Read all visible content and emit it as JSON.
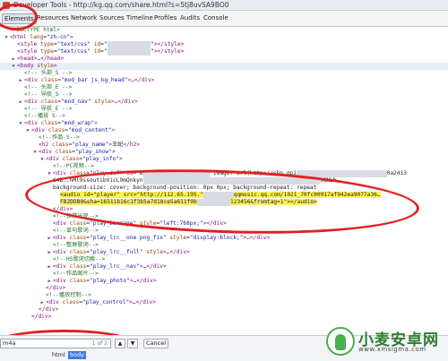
{
  "window": {
    "title": "Developer Tools - http://kg.qq.com/share.html?s=5tj8uvSA9BO0"
  },
  "tabs": [
    "Elements",
    "Resources",
    "Network",
    "Sources",
    "Timeline",
    "Profiles",
    "Audits",
    "Console"
  ],
  "selected_tab": "Elements",
  "code_lines": [
    {
      "indent": 0,
      "arrow": "",
      "segs": [
        {
          "c": "cmt",
          "t": "<!DOCTYPE html>"
        }
      ]
    },
    {
      "indent": 0,
      "arrow": "▼",
      "segs": [
        {
          "c": "tag",
          "t": "<html "
        },
        {
          "c": "attr",
          "t": "lang"
        },
        {
          "c": "plain",
          "t": "="
        },
        {
          "c": "val",
          "t": "\"zh-cn\""
        },
        {
          "c": "tag",
          "t": ">"
        }
      ]
    },
    {
      "indent": 1,
      "arrow": "",
      "segs": [
        {
          "c": "tag",
          "t": "<style "
        },
        {
          "c": "attr",
          "t": "type"
        },
        {
          "c": "plain",
          "t": "="
        },
        {
          "c": "val",
          "t": "\"text/css\" "
        },
        {
          "c": "attr",
          "t": "id"
        },
        {
          "c": "plain",
          "t": "=\""
        },
        {
          "c": "blur",
          "t": "xxxxxxxxxxxxx"
        },
        {
          "c": "plain",
          "t": "\""
        },
        {
          "c": "tag",
          "t": "></style>"
        }
      ]
    },
    {
      "indent": 1,
      "arrow": "",
      "segs": [
        {
          "c": "tag",
          "t": "<style "
        },
        {
          "c": "attr",
          "t": "type"
        },
        {
          "c": "plain",
          "t": "="
        },
        {
          "c": "val",
          "t": "\"text/css\" "
        },
        {
          "c": "attr",
          "t": "id"
        },
        {
          "c": "plain",
          "t": "=\""
        },
        {
          "c": "blur",
          "t": "xxxxxxxxxxxxx"
        },
        {
          "c": "plain",
          "t": "\""
        },
        {
          "c": "tag",
          "t": "></style>"
        }
      ]
    },
    {
      "indent": 1,
      "arrow": "▶",
      "segs": [
        {
          "c": "tag",
          "t": "<head>"
        },
        {
          "c": "plain",
          "t": "…"
        },
        {
          "c": "tag",
          "t": "</head>"
        }
      ]
    },
    {
      "indent": 1,
      "arrow": "▼",
      "segs": [
        {
          "c": "tag",
          "t": "<body "
        },
        {
          "c": "attr",
          "t": "style"
        },
        {
          "c": "tag",
          "t": ">"
        }
      ]
    },
    {
      "indent": 2,
      "arrow": "",
      "segs": [
        {
          "c": "cmt",
          "t": "<!-- 头部_S -->"
        }
      ]
    },
    {
      "indent": 2,
      "arrow": "▶",
      "segs": [
        {
          "c": "tag",
          "t": "<div "
        },
        {
          "c": "attr",
          "t": "class"
        },
        {
          "c": "plain",
          "t": "="
        },
        {
          "c": "val",
          "t": "\"mod_bar js_kg_head\""
        },
        {
          "c": "tag",
          "t": ">"
        },
        {
          "c": "plain",
          "t": "…"
        },
        {
          "c": "tag",
          "t": "</div>"
        }
      ]
    },
    {
      "indent": 2,
      "arrow": "",
      "segs": [
        {
          "c": "cmt",
          "t": "<!-- 头部_E -->"
        }
      ]
    },
    {
      "indent": 2,
      "arrow": "",
      "segs": [
        {
          "c": "cmt",
          "t": "<!-- 导航_S -->"
        }
      ]
    },
    {
      "indent": 2,
      "arrow": "▶",
      "segs": [
        {
          "c": "tag",
          "t": "<div "
        },
        {
          "c": "attr",
          "t": "class"
        },
        {
          "c": "plain",
          "t": "="
        },
        {
          "c": "val",
          "t": "\"mod_nav\" "
        },
        {
          "c": "attr",
          "t": "style"
        },
        {
          "c": "tag",
          "t": ">"
        },
        {
          "c": "plain",
          "t": "…"
        },
        {
          "c": "tag",
          "t": "</div>"
        }
      ]
    },
    {
      "indent": 2,
      "arrow": "",
      "segs": [
        {
          "c": "cmt",
          "t": "<!-- 导航_E -->"
        }
      ]
    },
    {
      "indent": 2,
      "arrow": "",
      "segs": [
        {
          "c": "cmt",
          "t": "<!--播放 S-->"
        }
      ]
    },
    {
      "indent": 2,
      "arrow": "▼",
      "segs": [
        {
          "c": "tag",
          "t": "<div "
        },
        {
          "c": "attr",
          "t": "class"
        },
        {
          "c": "plain",
          "t": "="
        },
        {
          "c": "val",
          "t": "\"mod_wrap\""
        },
        {
          "c": "tag",
          "t": ">"
        }
      ]
    },
    {
      "indent": 3,
      "arrow": "▼",
      "segs": [
        {
          "c": "tag",
          "t": "<div "
        },
        {
          "c": "attr",
          "t": "class"
        },
        {
          "c": "plain",
          "t": "="
        },
        {
          "c": "val",
          "t": "\"mod_content\""
        },
        {
          "c": "tag",
          "t": ">"
        }
      ]
    },
    {
      "indent": 4,
      "arrow": "",
      "segs": [
        {
          "c": "cmt",
          "t": "<!--作品 S-->"
        }
      ]
    },
    {
      "indent": 4,
      "arrow": "",
      "segs": [
        {
          "c": "tag",
          "t": "<h2 "
        },
        {
          "c": "attr",
          "t": "class"
        },
        {
          "c": "plain",
          "t": "="
        },
        {
          "c": "val",
          "t": "\"play_name\""
        },
        {
          "c": "tag",
          "t": ">"
        },
        {
          "c": "plain",
          "t": "王妃"
        },
        {
          "c": "tag",
          "t": "</h2>"
        }
      ]
    },
    {
      "indent": 4,
      "arrow": "▼",
      "segs": [
        {
          "c": "tag",
          "t": "<div "
        },
        {
          "c": "attr",
          "t": "class"
        },
        {
          "c": "plain",
          "t": "="
        },
        {
          "c": "val",
          "t": "\"play_show\""
        },
        {
          "c": "tag",
          "t": ">"
        }
      ]
    },
    {
      "indent": 5,
      "arrow": "▼",
      "segs": [
        {
          "c": "tag",
          "t": "<div "
        },
        {
          "c": "attr",
          "t": "class"
        },
        {
          "c": "plain",
          "t": "="
        },
        {
          "c": "val",
          "t": "\"play_info\""
        },
        {
          "c": "tag",
          "t": ">"
        }
      ]
    },
    {
      "indent": 6,
      "arrow": "",
      "segs": [
        {
          "c": "cmt",
          "t": "<!--PC视频-->"
        }
      ]
    },
    {
      "indent": 6,
      "arrow": "▼",
      "segs": [
        {
          "c": "tag",
          "t": "<div "
        },
        {
          "c": "attr",
          "t": "class"
        },
        {
          "c": "plain",
          "t": "="
        },
        {
          "c": "val",
          "t": "\"play_swf\" "
        },
        {
          "c": "attr",
          "t": "id"
        },
        {
          "c": "plain",
          "t": "=\"m"
        },
        {
          "c": "blur",
          "t": "xxxxxxxxxxxxxxxxxxxx"
        },
        {
          "c": "plain",
          "t": "   image: url(http://shp.qpi"
        },
        {
          "c": "blur",
          "t": "xxxxxxxxxxxxxxxxxxxxxxxxxxx"
        },
        {
          "c": "plain",
          "t": "0a2413"
        }
      ]
    },
    {
      "indent": 6,
      "arrow": "",
      "segs": [
        {
          "c": "plain",
          "t": "64B..hMl9ssoutibVicL9mOnkyn"
        },
        {
          "c": "blur",
          "t": "xxxxxxxxxxxxxxxxxxxxxxxxxxxxxxxxxxxxxxxxxxxxxxxxxxxxx"
        },
        {
          "c": "plain",
          "t": "9GNLb"
        }
      ]
    },
    {
      "indent": 6,
      "arrow": "",
      "segs": [
        {
          "c": "plain",
          "t": "background-size: cover; background-position: 0px 0px; background-repeat: repeat"
        }
      ]
    },
    {
      "indent": 7,
      "arrow": "",
      "segs": [
        {
          "c": "hlrow",
          "t": "<audio id=\"player\" src=\"http://112.65.195.\""
        },
        {
          "c": "blur",
          "t": "xxxxxxxxx"
        },
        {
          "c": "hlrow",
          "t": "qqmusic.qq.com/1021_70fc00917af942ea9077a36…"
        }
      ]
    },
    {
      "indent": 7,
      "arrow": "",
      "segs": [
        {
          "c": "hlrow",
          "t": "FB2DDB0&sha=16511b16c1f3b5a7d18ce5a611f9b"
        },
        {
          "c": "blur",
          "t": "xxxxxxxxxx"
        },
        {
          "c": "hlrow",
          "t": "123456&fromtag=1\"></audio>"
        }
      ]
    },
    {
      "indent": 6,
      "arrow": "",
      "segs": [
        {
          "c": "tag",
          "t": "</div>"
        }
      ]
    },
    {
      "indent": 6,
      "arrow": "",
      "segs": [
        {
          "c": "cmt",
          "t": "<!--弹幕出现-->"
        }
      ]
    },
    {
      "indent": 6,
      "arrow": "",
      "segs": [
        {
          "c": "tag",
          "t": "<div "
        },
        {
          "c": "attr",
          "t": "class"
        },
        {
          "c": "plain",
          "t": "="
        },
        {
          "c": "val",
          "t": "\"play_barrage\" "
        },
        {
          "c": "attr",
          "t": "style"
        },
        {
          "c": "plain",
          "t": "="
        },
        {
          "c": "val",
          "t": "\"left:768px;\""
        },
        {
          "c": "tag",
          "t": "></div>"
        }
      ]
    },
    {
      "indent": 6,
      "arrow": "",
      "segs": [
        {
          "c": "cmt",
          "t": "<!--单句歌词-->"
        }
      ]
    },
    {
      "indent": 6,
      "arrow": "▶",
      "segs": [
        {
          "c": "tag",
          "t": "<div "
        },
        {
          "c": "attr",
          "t": "class"
        },
        {
          "c": "plain",
          "t": "="
        },
        {
          "c": "val",
          "t": "\"play_lrc__one png_fix\" "
        },
        {
          "c": "attr",
          "t": "style"
        },
        {
          "c": "plain",
          "t": "="
        },
        {
          "c": "val",
          "t": "\"display:block;\""
        },
        {
          "c": "tag",
          "t": ">"
        },
        {
          "c": "plain",
          "t": "…"
        },
        {
          "c": "tag",
          "t": "</div>"
        }
      ]
    },
    {
      "indent": 6,
      "arrow": "",
      "segs": [
        {
          "c": "cmt",
          "t": "<!--整屏歌词-->"
        }
      ]
    },
    {
      "indent": 6,
      "arrow": "▶",
      "segs": [
        {
          "c": "tag",
          "t": "<div "
        },
        {
          "c": "attr",
          "t": "class"
        },
        {
          "c": "plain",
          "t": "="
        },
        {
          "c": "val",
          "t": "\"play_lrc__full\" "
        },
        {
          "c": "attr",
          "t": "style"
        },
        {
          "c": "tag",
          "t": ">"
        },
        {
          "c": "plain",
          "t": "…"
        },
        {
          "c": "tag",
          "t": "</div>"
        }
      ]
    },
    {
      "indent": 6,
      "arrow": "",
      "segs": [
        {
          "c": "cmt",
          "t": "<!--HS歌词切换-->"
        }
      ]
    },
    {
      "indent": 6,
      "arrow": "▶",
      "segs": [
        {
          "c": "tag",
          "t": "<div "
        },
        {
          "c": "attr",
          "t": "class"
        },
        {
          "c": "plain",
          "t": "="
        },
        {
          "c": "val",
          "t": "\"play_lrc__nav\""
        },
        {
          "c": "tag",
          "t": ">"
        },
        {
          "c": "plain",
          "t": "…"
        },
        {
          "c": "tag",
          "t": "</div>"
        }
      ]
    },
    {
      "indent": 6,
      "arrow": "",
      "segs": [
        {
          "c": "cmt",
          "t": "<!--作品图片-->"
        }
      ]
    },
    {
      "indent": 6,
      "arrow": "▶",
      "segs": [
        {
          "c": "tag",
          "t": "<div "
        },
        {
          "c": "attr",
          "t": "class"
        },
        {
          "c": "plain",
          "t": "="
        },
        {
          "c": "val",
          "t": "\"play_photo\""
        },
        {
          "c": "tag",
          "t": ">"
        },
        {
          "c": "plain",
          "t": "…"
        },
        {
          "c": "tag",
          "t": "</div>"
        }
      ]
    },
    {
      "indent": 5,
      "arrow": "",
      "segs": [
        {
          "c": "tag",
          "t": "</div>"
        }
      ]
    },
    {
      "indent": 5,
      "arrow": "",
      "segs": [
        {
          "c": "cmt",
          "t": "<!--播放控制-->"
        }
      ]
    },
    {
      "indent": 5,
      "arrow": "▶",
      "segs": [
        {
          "c": "tag",
          "t": "<div "
        },
        {
          "c": "attr",
          "t": "class"
        },
        {
          "c": "plain",
          "t": "="
        },
        {
          "c": "val",
          "t": "\"play_control\""
        },
        {
          "c": "tag",
          "t": ">"
        },
        {
          "c": "plain",
          "t": "…"
        },
        {
          "c": "tag",
          "t": "</div>"
        }
      ]
    },
    {
      "indent": 4,
      "arrow": "",
      "segs": [
        {
          "c": "tag",
          "t": "</div>"
        }
      ]
    },
    {
      "indent": 3,
      "arrow": "",
      "segs": [
        {
          "c": "tag",
          "t": "</div>"
        }
      ]
    }
  ],
  "search": {
    "value": "m4a",
    "counter": "1 of 2"
  },
  "search_buttons": {
    "prev": "▲",
    "next": "▼",
    "cancel": "Cancel"
  },
  "breadcrumbs": [
    "html",
    "body"
  ],
  "selected_crumb": "body",
  "watermark": {
    "name": "小麦安卓网",
    "url": "www.xmsigma.com"
  },
  "colors": {
    "annotation": "#e02020",
    "highlight": "#fff15a",
    "tag": "#881280",
    "attr": "#994500",
    "value": "#1a1aa6",
    "comment": "#236e25"
  }
}
